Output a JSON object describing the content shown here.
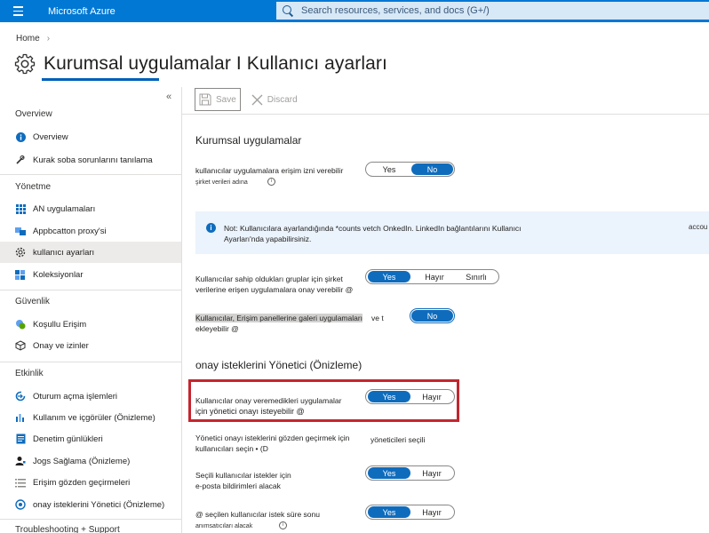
{
  "topbar": {
    "brand": "Microsoft Azure",
    "search_placeholder": "Search resources, services, and docs (G+/)"
  },
  "breadcrumb": {
    "home": "Home"
  },
  "page": {
    "title": "Kurumsal uygulamalar I Kullanıcı ayarları"
  },
  "sidebar": {
    "collapse_glyph": "«",
    "sections": [
      {
        "heading": "Overview",
        "items": [
          {
            "label": "Overview",
            "icon": "info-icon"
          },
          {
            "label": "Kurak soba sorunlarını tanılama",
            "icon": "wrench-icon"
          }
        ]
      },
      {
        "heading": "Yönetme",
        "items": [
          {
            "label": "AN uygulamaları",
            "icon": "grid-icon"
          },
          {
            "label": "Appbcatton proxy'si",
            "icon": "proxy-icon"
          },
          {
            "label": "kullanıcı ayarları",
            "icon": "gear-icon",
            "active": true
          },
          {
            "label": "Koleksiyonlar",
            "icon": "collection-icon"
          }
        ]
      },
      {
        "heading": "Güvenlik",
        "items": [
          {
            "label": "Koşullu Erişim",
            "icon": "conditional-access-icon"
          },
          {
            "label": "Onay ve izinler",
            "icon": "cube-icon"
          }
        ]
      },
      {
        "heading": "Etkinlik",
        "items": [
          {
            "label": "Oturum açma işlemleri",
            "icon": "signin-icon"
          },
          {
            "label": "Kullanım ve içgörüler (Önizleme)",
            "icon": "bar-chart-icon"
          },
          {
            "label": "Denetim günlükleri",
            "icon": "log-icon"
          },
          {
            "label": "Jogs Sağlama (Önizleme)",
            "icon": "person-icon"
          },
          {
            "label": "Erişim gözden geçirmeleri",
            "icon": "list-icon"
          },
          {
            "label": "onay isteklerini Yönetici (Önizleme)",
            "icon": "consent-icon"
          }
        ]
      },
      {
        "heading": "Troubleshooting + Support",
        "items": []
      }
    ]
  },
  "toolbar": {
    "save": "Save",
    "discard": "Discard"
  },
  "sections": {
    "enterprise_apps": "Kurumsal uygulamalar",
    "admin_consent": "onay isteklerini Yönetici (Önizleme)"
  },
  "settings": {
    "s1": {
      "line1": "kullanıcılar uygulamalara erişim izni verebilir",
      "line2": "şirket verileri adına",
      "opts": [
        "Yes",
        "No"
      ]
    },
    "s2": {
      "line1": "Kullanıcılar sahip oldukları gruplar için şirket",
      "line2": "verilerine erişen uygulamalara onay verebilir @",
      "opts": [
        "Yes",
        "Hayır",
        "Sınırlı"
      ]
    },
    "s3": {
      "line1": "Kullanıcılar, Erişim panellerine galeri uygulamaları",
      "line2": "ekleyebilir @",
      "mid": "ve t",
      "opts": [
        "No"
      ]
    },
    "s4": {
      "line1": "Kullanıcılar onay veremedikleri uygulamalar",
      "line2": "için yönetici onayı isteyebilir @",
      "opts": [
        "Yes",
        "Hayır"
      ]
    },
    "s5": {
      "line1": "Yönetici onayı isteklerini gözden geçirmek için",
      "line2": "kullanıcıları seçin • (D",
      "value": "yöneticileri seçili"
    },
    "s6": {
      "line1": "Seçili kullanıcılar istekler için",
      "line2": "e-posta bildirimleri alacak",
      "opts": [
        "Yes",
        "Hayır"
      ]
    },
    "s7": {
      "line1": "@ seçilen kullanıcılar istek süre sonu",
      "line2": "anımsatıcıları alacak",
      "opts": [
        "Yes",
        "Hayır"
      ]
    }
  },
  "info_banner": {
    "text": "Not: Kullanıcılara ayarlandığında *counts vetch OnkedIn. LinkedIn bağlantılarını Kullanıcı Ayarları'nda yapabilirsiniz.",
    "trailing": "accou"
  },
  "colors": {
    "azure_blue": "#0078d4",
    "toggle_selected": "#0f6cbd",
    "highlight_red": "#c4262e"
  }
}
